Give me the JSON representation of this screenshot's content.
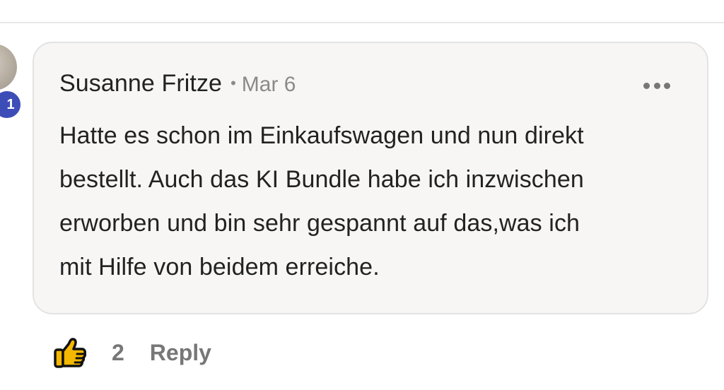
{
  "comment": {
    "author": "Susanne Fritze",
    "separator": "•",
    "date": "Mar 6",
    "body_lines": [
      "Hatte es schon im Einkaufswagen und nun direkt",
      "bestellt. Auch das KI Bundle habe ich inzwischen",
      "erworben und bin sehr gespannt auf das,was ich",
      "mit Hilfe von beidem erreiche."
    ],
    "level_badge": "1",
    "more_icon": "ellipsis-horizontal-icon"
  },
  "actions": {
    "like_icon": "thumbs-up-icon",
    "like_count": "2",
    "reply_label": "Reply"
  },
  "colors": {
    "bubble_background": "#f7f6f5",
    "badge_background": "#3d4db7",
    "like_fill": "#f5b800",
    "muted_text": "#777777",
    "primary_text": "#222222"
  }
}
